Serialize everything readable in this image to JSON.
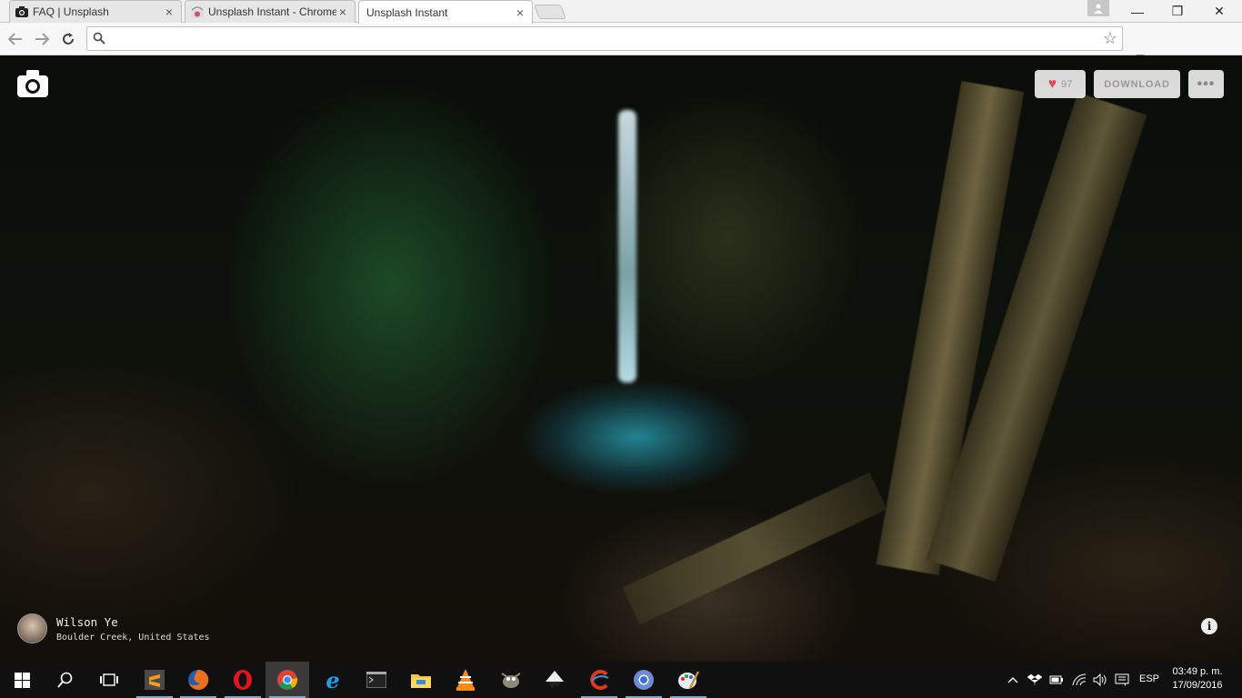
{
  "browser": {
    "tabs": [
      {
        "title": "FAQ | Unsplash",
        "icon": "camera-icon"
      },
      {
        "title": "Unsplash Instant - Chrome",
        "icon": "chrome-webstore-icon"
      },
      {
        "title": "Unsplash Instant",
        "icon": "none"
      }
    ],
    "close_glyph": "×",
    "omnibox": {
      "value": "",
      "placeholder": ""
    },
    "window_controls": {
      "minimize": "—",
      "restore": "❐",
      "close": "✕"
    }
  },
  "page": {
    "likes": "97",
    "download_label": "DOWNLOAD",
    "more_label": "•••",
    "photographer": "Wilson Ye",
    "location": "Boulder Creek, United States",
    "info_glyph": "i"
  },
  "taskbar": {
    "apps": [
      "start",
      "search",
      "task-view",
      "sublime-text",
      "firefox",
      "opera",
      "chrome",
      "internet-explorer",
      "cmd",
      "file-explorer",
      "vlc",
      "gimp",
      "inkscape",
      "ccleaner",
      "chromium",
      "paint"
    ],
    "language": "ESP",
    "time": "03:49 p. m.",
    "date": "17/09/2016"
  },
  "colors": {
    "accent_heart": "#e0495a",
    "taskbar": "#101010",
    "running_indicator": "#7aa7d6"
  }
}
